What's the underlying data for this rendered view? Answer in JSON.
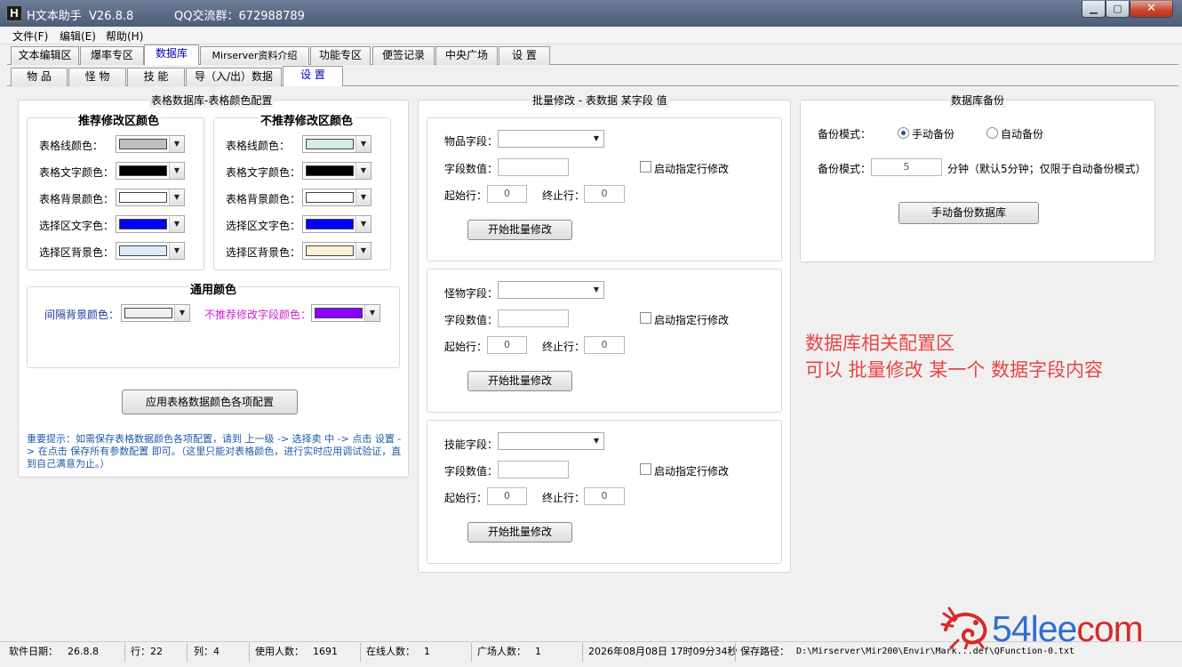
{
  "window": {
    "icon_letter": "H",
    "title": "H文本助手  V26.8.8",
    "qq_group": "QQ交流群：672988789",
    "min_glyph": "▁",
    "max_glyph": "▢",
    "close_glyph": "✕"
  },
  "menu": [
    "文件(F)",
    "编辑(E)",
    "帮助(H)"
  ],
  "tabs_main": [
    "文本编辑区",
    "爆率专区",
    "数据库",
    "Mirserver资料介绍",
    "功能专区",
    "便签记录",
    "中央广场",
    "设  置"
  ],
  "tabs_sub": [
    "物  品",
    "怪  物",
    "技  能",
    "导（入/出）数据",
    "设  置"
  ],
  "color_config": {
    "title": "表格数据库-表格颜色配置",
    "recommended": {
      "title": "推荐修改区颜色",
      "rows": [
        {
          "label": "表格线颜色：",
          "color": "#c0c0c0"
        },
        {
          "label": "表格文字颜色：",
          "color": "#000000"
        },
        {
          "label": "表格背景颜色：",
          "color": "#ffffff"
        },
        {
          "label": "选择区文字色：",
          "color": "#0000ff"
        },
        {
          "label": "选择区背景色：",
          "color": "#dceafa"
        }
      ]
    },
    "not_recommended": {
      "title": "不推荐修改区颜色",
      "rows": [
        {
          "label": "表格线颜色：",
          "color": "#d4ece2"
        },
        {
          "label": "表格文字颜色：",
          "color": "#000000"
        },
        {
          "label": "表格背景颜色：",
          "color": "#ffffff"
        },
        {
          "label": "选择区文字色：",
          "color": "#0000ff"
        },
        {
          "label": "选择区背景色：",
          "color": "#fff0d4"
        }
      ]
    },
    "common": {
      "title": "通用颜色",
      "interval_label": "间隔背景颜色：",
      "interval_color": "#f0f0f0",
      "interval_label_color": "#1a3a9c",
      "not_rec_label": "不推荐修改字段颜色：",
      "not_rec_color": "#8a00ff",
      "not_rec_label_color": "#d020d0"
    },
    "apply_button": "应用表格数据颜色各项配置",
    "hint": "重要提示：如需保存表格数据颜色各项配置，请到 上一级 -> 选择卖 中 -> 点击 设置 -> 在点击 保存所有参数配置 即可。（这里只能对表格颜色，进行实时应用调试验证，直到自己满意为止。）"
  },
  "batch": {
    "title": "批量修改 - 表数据 某字段 值",
    "sections": [
      {
        "field_label": "物品字段：",
        "value_label": "字段数值：",
        "checkbox_label": "启动指定行修改",
        "start_label": "起始行：",
        "start_value": "0",
        "end_label": "终止行：",
        "end_value": "0",
        "button": "开始批量修改"
      },
      {
        "field_label": "怪物字段：",
        "value_label": "字段数值：",
        "checkbox_label": "启动指定行修改",
        "start_label": "起始行：",
        "start_value": "0",
        "end_label": "终止行：",
        "end_value": "0",
        "button": "开始批量修改"
      },
      {
        "field_label": "技能字段：",
        "value_label": "字段数值：",
        "checkbox_label": "启动指定行修改",
        "start_label": "起始行：",
        "start_value": "0",
        "end_label": "终止行：",
        "end_value": "0",
        "button": "开始批量修改"
      }
    ]
  },
  "backup": {
    "title": "数据库备份",
    "mode_label": "备份模式：",
    "manual_label": "手动备份",
    "auto_label": "自动备份",
    "selected": "manual",
    "interval_label": "备份模式：",
    "interval_value": "5",
    "interval_hint": "分钟（默认5分钟；仅限于自动备份模式）",
    "button": "手动备份数据库"
  },
  "annotation": {
    "line1": "数据库相关配置区",
    "line2": "可以 批量修改  某一个 数据字段内容",
    "color": "#e84545"
  },
  "status": {
    "date_label": "软件日期：",
    "date_value": "26.8.8",
    "row_label": "行：22",
    "col_label": "列：4",
    "users_label": "使用人数：",
    "users_value": "1691",
    "online_label": "在线人数：",
    "online_value": "1",
    "plaza_label": "广场人数：",
    "plaza_value": "1",
    "datetime": "2026年08月08日  17时09分34秒",
    "path_label": "保存路径：",
    "path_value": "D:\\Mirserver\\Mir200\\Envir\\Mark...def\\QFunction-0.txt"
  },
  "watermark": {
    "blue": "54lee",
    "red": "com"
  }
}
